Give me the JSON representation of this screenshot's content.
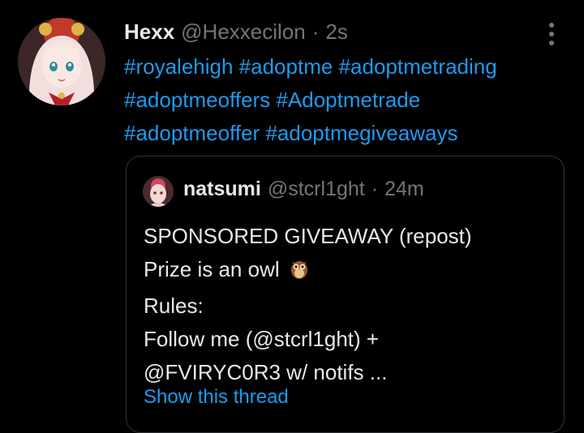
{
  "tweet": {
    "display_name": "Hexx",
    "handle": "@Hexxecilon",
    "separator": "·",
    "time": "2s",
    "hashtags": [
      "#royalehigh",
      "#adoptme",
      "#adoptmetrading",
      "#adoptmeoffers",
      "#Adoptmetrade",
      "#adoptmeoffer",
      "#adoptmegiveaways"
    ]
  },
  "quote": {
    "display_name": "natsumi",
    "handle": "@stcrl1ght",
    "separator": "·",
    "time": "24m",
    "lines": [
      "SPONSORED GIVEAWAY (repost)",
      "Prize is an owl",
      "Rules:",
      "Follow me (@stcrl1ght) +",
      "@FVIRYC0R3 w/ notifs ..."
    ],
    "show_thread": "Show this thread"
  },
  "icons": {
    "more": "more-options-icon",
    "owl": "owl-emoji-icon"
  },
  "colors": {
    "background": "#000000",
    "text": "#e7e9ea",
    "muted": "#71767b",
    "link": "#1d9bf0",
    "border": "#2f3336"
  }
}
